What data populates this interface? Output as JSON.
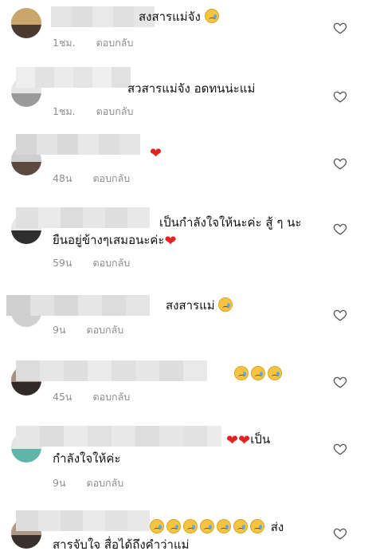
{
  "comments": [
    {
      "text": "สงสารแม่จัง",
      "emoji": "😭",
      "time": "1ชม.",
      "reply": "ตอบกลับ"
    },
    {
      "text": "สวสารแม่จัง อดทนน่ะแม่",
      "time": "1ชม.",
      "reply": "ตอบกลับ"
    },
    {
      "text": "",
      "emoji": "❤️",
      "time": "48น",
      "reply": "ตอบกลับ"
    },
    {
      "text": "เป็นกำลังใจให้นะค่ะ สู้ ๆ นะ",
      "text2": "ยืนอยู่ข้างๆเสมอนะค่ะ",
      "emoji": "❤️",
      "time": "59น",
      "reply": "ตอบกลับ"
    },
    {
      "text": "สงสารแม่",
      "emoji": "😢",
      "time": "9น",
      "reply": "ตอบกลับ"
    },
    {
      "text": "",
      "emoji": "😢😢😢",
      "time": "45น",
      "reply": "ตอบกลับ"
    },
    {
      "text": "เป็น",
      "text2": "กำลังใจให้ค่ะ",
      "emoji": "❤️❤️",
      "time": "9น",
      "reply": "ตอบกลับ"
    },
    {
      "text": "ส่ง",
      "text2": "สารจับใจ สื่อได้ถึงคำว่าแม่",
      "emoji": "😢😢😢😢😢😢😢",
      "time": "",
      "reply": ""
    }
  ],
  "icons": {
    "like": "heart-outline-icon"
  },
  "colors": {
    "meta": "#8e8e8e",
    "heart": "#e02424"
  }
}
